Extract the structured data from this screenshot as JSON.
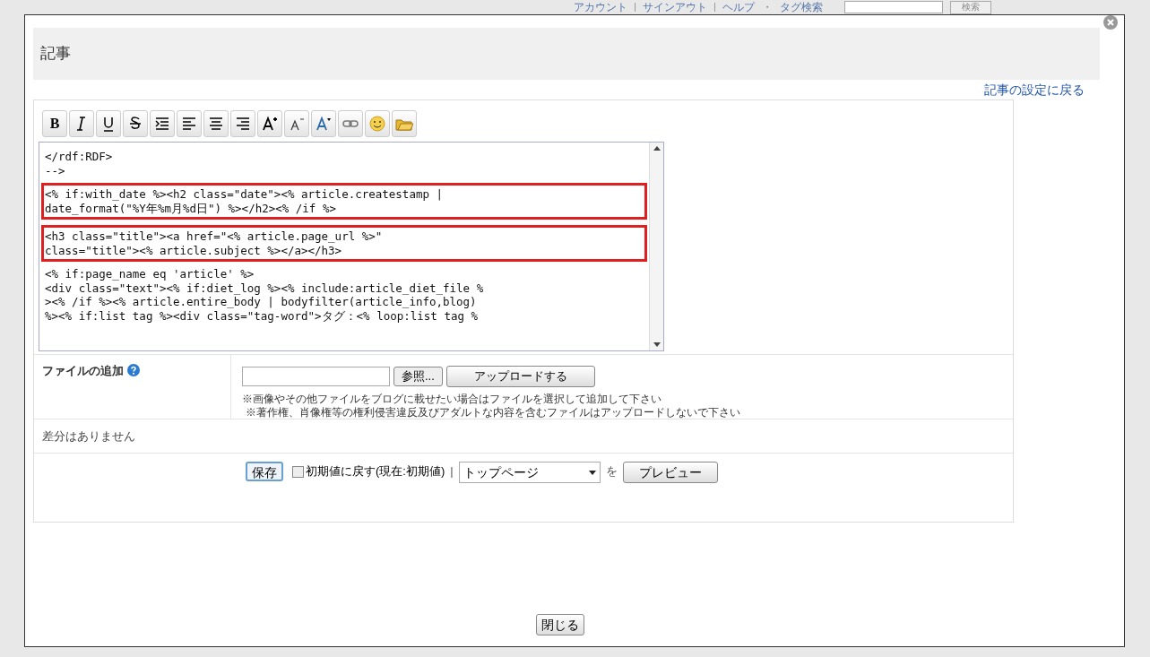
{
  "background_header": {
    "links": [
      "アカウント",
      "サインアウト",
      "ヘルプ",
      "タグ検索"
    ],
    "dot_separator": "・",
    "search_button": "検索"
  },
  "dialog": {
    "title": "記事",
    "back_link": "記事の設定に戻る",
    "toolbar": [
      {
        "kind": "bold",
        "label": "B"
      },
      {
        "kind": "italic"
      },
      {
        "kind": "underline"
      },
      {
        "kind": "strike"
      },
      {
        "kind": "indent"
      },
      {
        "kind": "align-left"
      },
      {
        "kind": "align-center"
      },
      {
        "kind": "align-right"
      },
      {
        "kind": "font-bigger"
      },
      {
        "kind": "font-smaller"
      },
      {
        "kind": "font-color"
      },
      {
        "kind": "link"
      },
      {
        "kind": "emoji"
      },
      {
        "kind": "folder"
      }
    ],
    "code_blocks": [
      {
        "highlighted": false,
        "lines": [
          "</rdf:RDF>",
          "-->"
        ]
      },
      {
        "highlighted": true,
        "lines": [
          "<% if:with_date %><h2 class=\"date\"><% article.createstamp |",
          "date_format(\"%Y年%m月%d日\") %></h2><% /if %>"
        ]
      },
      {
        "highlighted": true,
        "lines": [
          "<h3 class=\"title\"><a href=\"<% article.page_url %>\"",
          "class=\"title\"><% article.subject %></a></h3>"
        ]
      },
      {
        "highlighted": false,
        "lines": [
          "<% if:page_name eq 'article' %>",
          "<div class=\"text\"><% if:diet_log %><% include:article_diet_file %",
          "><% /if %><% article.entire_body | bodyfilter(article_info,blog)",
          "%><% if:list tag %><div class=\"tag-word\">タグ：<% loop:list tag %"
        ]
      }
    ],
    "file_label": "ファイルの追加",
    "browse_button": "参照...",
    "upload_button": "アップロードする",
    "notes": [
      "※画像やその他ファイルをブログに載せたい場合はファイルを選択して追加して下さい",
      "※著作権、肖像権等の権利侵害違反及びアダルトな内容を含むファイルはアップロードしないで下さい"
    ],
    "diff_message": "差分はありません",
    "save_button": "保存",
    "reset_checkbox": {
      "label": "初期値に戻す(現在:初期値)",
      "checked": false
    },
    "separator": "|",
    "page_select": "トップページ",
    "particle": "を",
    "preview_button": "プレビュー",
    "close_button": "閉じる"
  }
}
